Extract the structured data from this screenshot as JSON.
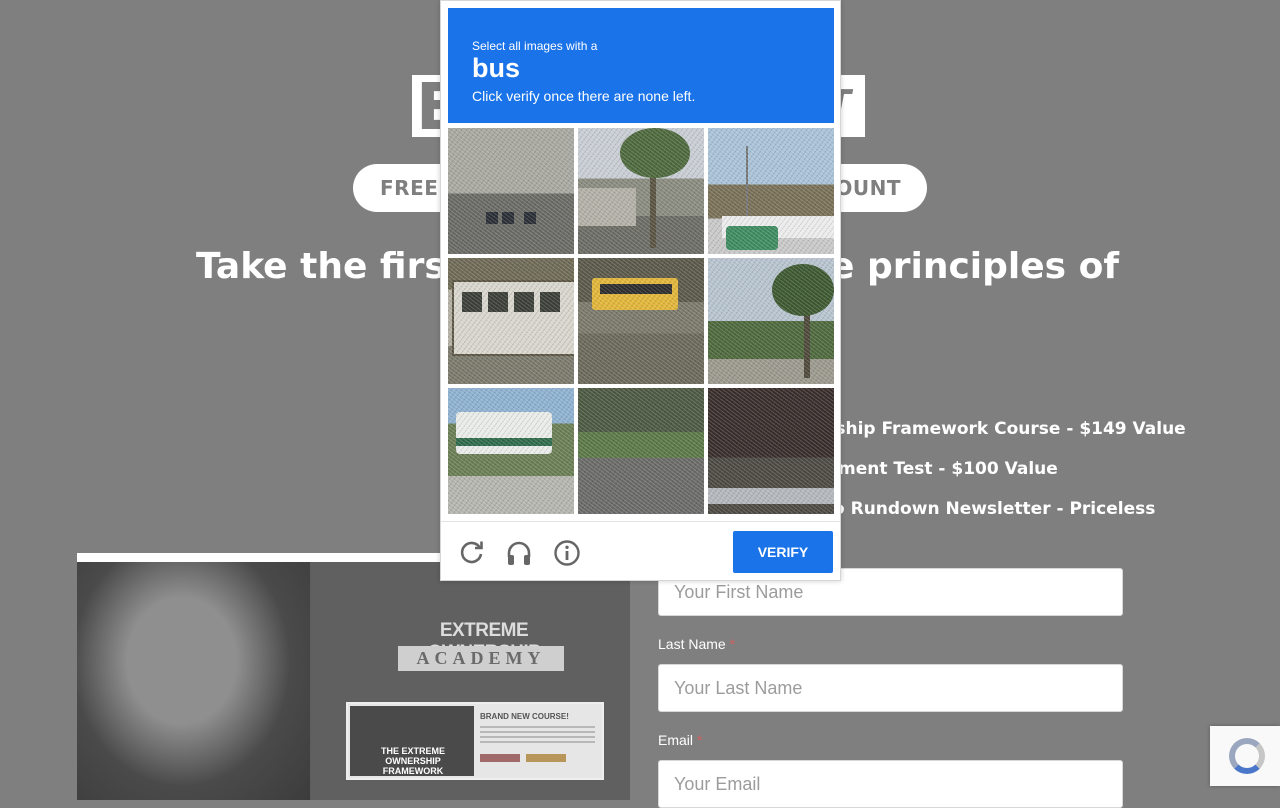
{
  "background": {
    "logo_first_letter": "E",
    "logo_last_letter": "T",
    "pill_left": "FREE",
    "pill_right": "OUNT",
    "headline_left": "Take the first",
    "headline_right": "e principles of",
    "benefits": [
      "rship Framework Course - $149 Value",
      "ment Test - $100 Value",
      "o Rundown Newsletter - Priceless"
    ],
    "promo": {
      "academy_title": "EXTREME OWNERSHIP",
      "academy_sub": "ACADEMY",
      "course_new": "BRAND NEW COURSE!",
      "course_thumb_text": "THE EXTREME OWNERSHIP FRAMEWORK"
    },
    "form": {
      "first_name_placeholder": "Your First Name",
      "last_name_label": "Last Name",
      "last_name_placeholder": "Your Last Name",
      "email_label": "Email",
      "email_placeholder": "Your Email",
      "required_mark": "*"
    }
  },
  "captcha": {
    "prompt_small": "Select all images with a",
    "prompt_target": "bus",
    "prompt_hint": "Click verify once there are none left.",
    "verify_label": "VERIFY",
    "tiles": [
      "tile-1",
      "tile-2",
      "tile-3",
      "tile-4",
      "tile-5",
      "tile-6",
      "tile-7",
      "tile-8",
      "tile-9"
    ],
    "icons": [
      "reload-icon",
      "headphones-icon",
      "info-icon"
    ]
  },
  "colors": {
    "accent": "#1a73e8",
    "overlay": "#7f7f7f"
  }
}
